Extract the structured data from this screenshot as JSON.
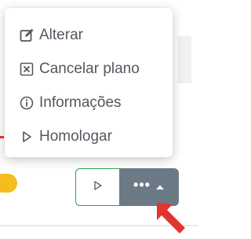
{
  "menu": {
    "items": [
      {
        "label": "Alterar",
        "icon": "edit-icon"
      },
      {
        "label": "Cancelar plano",
        "icon": "close-box-icon"
      },
      {
        "label": "Informações",
        "icon": "info-icon"
      },
      {
        "label": "Homologar",
        "icon": "play-icon"
      }
    ]
  },
  "actions": {
    "play_icon": "play-icon",
    "more_label": "•••",
    "more_icon": "caret-up-icon"
  },
  "colors": {
    "menu_text": "#52595f",
    "play_border": "#28a745",
    "more_bg": "#6c7a86",
    "status_dot": "#f4bd1c",
    "cursor": "#e3342f"
  }
}
